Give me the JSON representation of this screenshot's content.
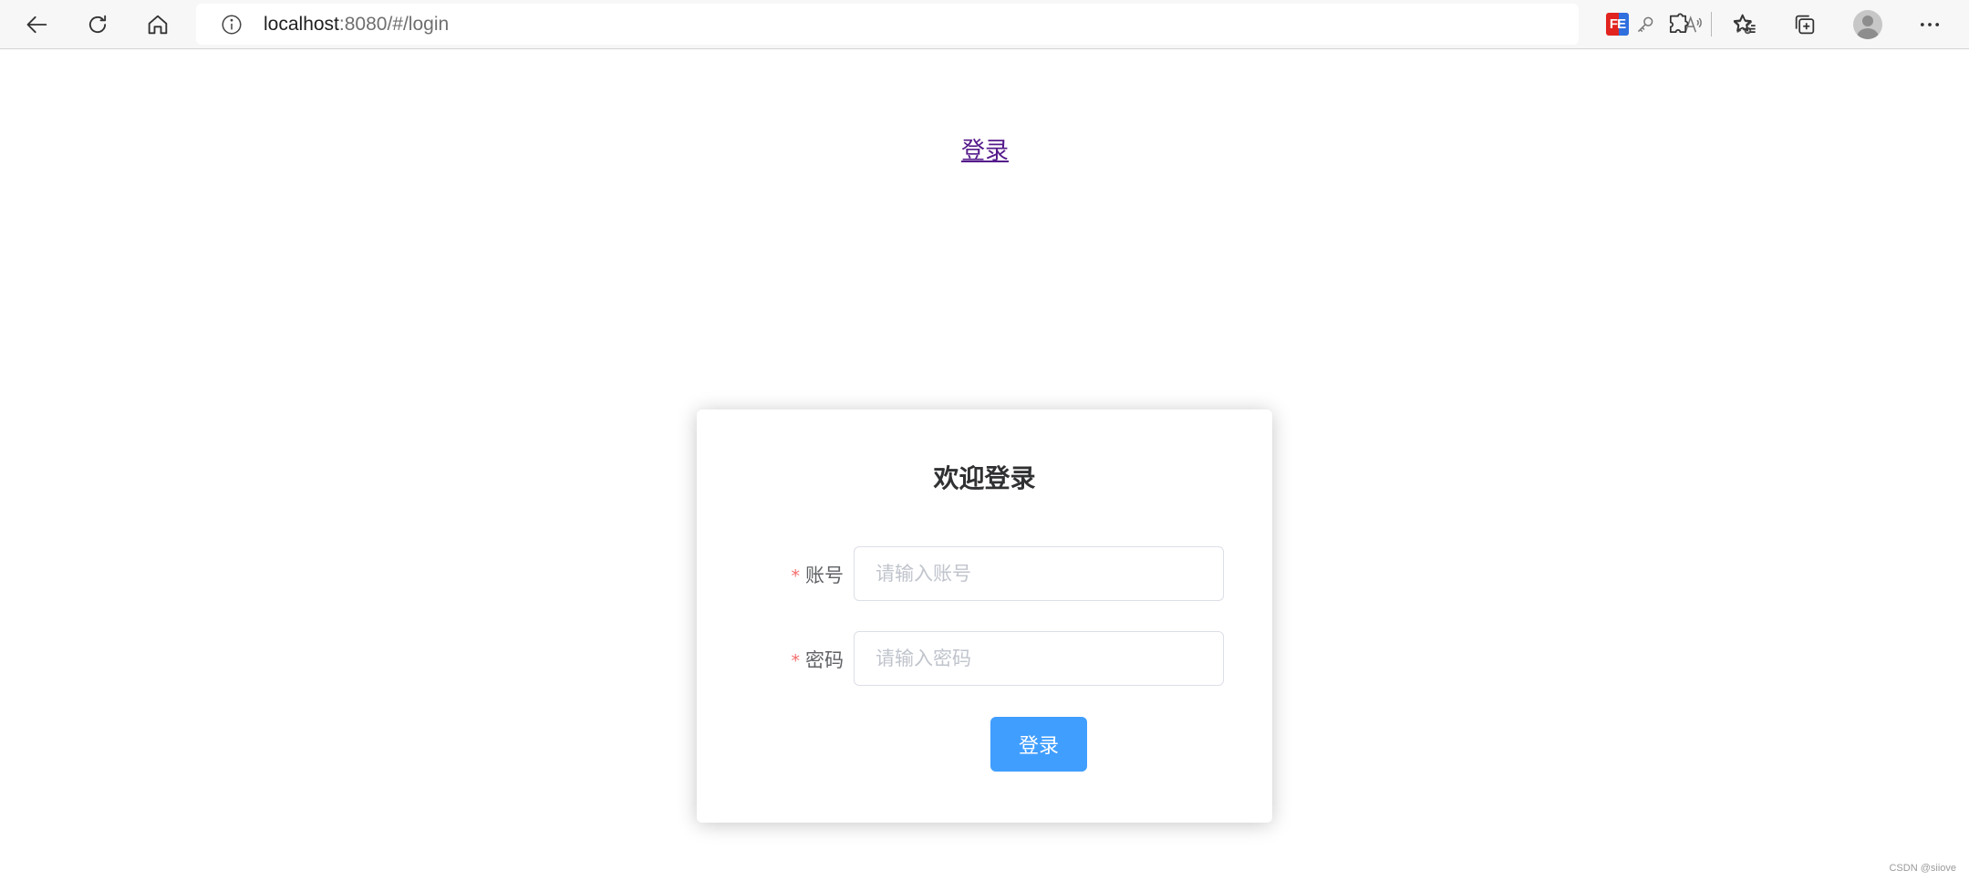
{
  "browser": {
    "url_host": "localhost",
    "url_rest": ":8080/#/login",
    "extension_badge": "FE",
    "icons": {
      "back": "back-arrow-icon",
      "refresh": "refresh-icon",
      "home": "home-icon",
      "site_info": "info-icon",
      "password": "key-icon",
      "read_aloud": "read-aloud-icon",
      "add_favorite": "add-favorite-icon",
      "extensions": "puzzle-icon",
      "favorites": "favorites-icon",
      "collections": "collections-icon",
      "profile": "profile-avatar-icon",
      "more": "more-icon"
    }
  },
  "page": {
    "top_link": "登录",
    "login_form": {
      "title": "欢迎登录",
      "account_label": "账号",
      "account_placeholder": "请输入账号",
      "account_value": "",
      "password_label": "密码",
      "password_placeholder": "请输入密码",
      "password_value": "",
      "required_mark": "*",
      "submit_label": "登录"
    },
    "watermark": "CSDN @siiove"
  },
  "colors": {
    "primary_button": "#409eff",
    "required_star": "#f56c6c",
    "visited_link": "#551a8b"
  }
}
